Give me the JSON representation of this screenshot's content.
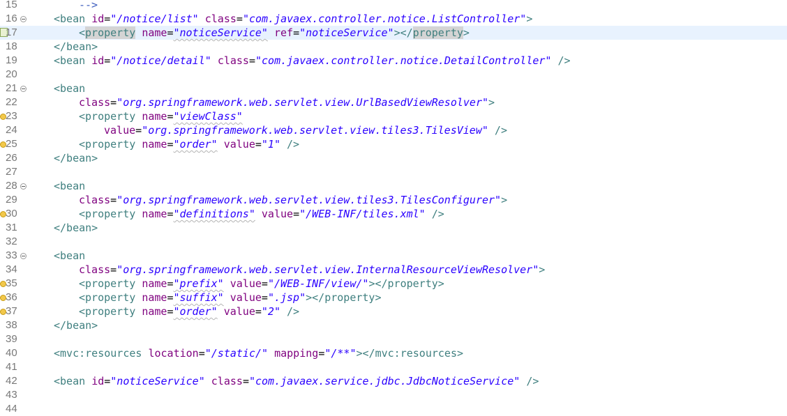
{
  "editor": {
    "current_line": 17,
    "lines": [
      {
        "n": "15",
        "fold": false,
        "marker": "",
        "indent": 1,
        "tokens": [
          {
            "t": "-->",
            "c": "comment"
          }
        ]
      },
      {
        "n": "16",
        "fold": true,
        "marker": "",
        "indent": 0,
        "tokens": [
          {
            "t": "<bean",
            "c": "tag"
          },
          {
            "t": " ",
            "c": "plain"
          },
          {
            "t": "id",
            "c": "attr"
          },
          {
            "t": "=",
            "c": "plain"
          },
          {
            "t": "\"/notice/list\"",
            "c": "val"
          },
          {
            "t": " ",
            "c": "plain"
          },
          {
            "t": "class",
            "c": "attr"
          },
          {
            "t": "=",
            "c": "plain"
          },
          {
            "t": "\"com.javaex.controller.notice.ListController\"",
            "c": "val"
          },
          {
            "t": ">",
            "c": "tag"
          }
        ]
      },
      {
        "n": "17",
        "fold": false,
        "marker": "bookmark",
        "indent": 1,
        "current": true,
        "tokens": [
          {
            "t": "<",
            "c": "tag"
          },
          {
            "t": "property",
            "c": "tag hl"
          },
          {
            "t": " ",
            "c": "plain"
          },
          {
            "t": "name",
            "c": "attr"
          },
          {
            "t": "=",
            "c": "plain"
          },
          {
            "t": "\"noticeService\"",
            "c": "val squig"
          },
          {
            "t": " ",
            "c": "plain"
          },
          {
            "t": "ref",
            "c": "attr"
          },
          {
            "t": "=",
            "c": "plain"
          },
          {
            "t": "\"noticeService\"",
            "c": "val"
          },
          {
            "t": "></",
            "c": "tag"
          },
          {
            "t": "property",
            "c": "tag hl"
          },
          {
            "t": ">",
            "c": "tag"
          }
        ]
      },
      {
        "n": "18",
        "fold": false,
        "marker": "",
        "indent": 0,
        "tokens": [
          {
            "t": "</bean>",
            "c": "tag"
          }
        ]
      },
      {
        "n": "19",
        "fold": false,
        "marker": "",
        "indent": 0,
        "tokens": [
          {
            "t": "<bean",
            "c": "tag"
          },
          {
            "t": " ",
            "c": "plain"
          },
          {
            "t": "id",
            "c": "attr"
          },
          {
            "t": "=",
            "c": "plain"
          },
          {
            "t": "\"/notice/detail\"",
            "c": "val"
          },
          {
            "t": " ",
            "c": "plain"
          },
          {
            "t": "class",
            "c": "attr"
          },
          {
            "t": "=",
            "c": "plain"
          },
          {
            "t": "\"com.javaex.controller.notice.DetailController\"",
            "c": "val"
          },
          {
            "t": " />",
            "c": "tag"
          }
        ]
      },
      {
        "n": "20",
        "fold": false,
        "marker": "",
        "indent": 0,
        "tokens": []
      },
      {
        "n": "21",
        "fold": true,
        "marker": "",
        "indent": 0,
        "tokens": [
          {
            "t": "<bean",
            "c": "tag"
          }
        ]
      },
      {
        "n": "22",
        "fold": false,
        "marker": "",
        "indent": 1,
        "tokens": [
          {
            "t": "class",
            "c": "attr"
          },
          {
            "t": "=",
            "c": "plain"
          },
          {
            "t": "\"org.springframework.web.servlet.view.UrlBasedViewResolver\"",
            "c": "val"
          },
          {
            "t": ">",
            "c": "tag"
          }
        ]
      },
      {
        "n": "23",
        "fold": false,
        "marker": "warning",
        "indent": 1,
        "tokens": [
          {
            "t": "<property",
            "c": "tag"
          },
          {
            "t": " ",
            "c": "plain"
          },
          {
            "t": "name",
            "c": "attr"
          },
          {
            "t": "=",
            "c": "plain"
          },
          {
            "t": "\"viewClass\"",
            "c": "val squig"
          }
        ]
      },
      {
        "n": "24",
        "fold": false,
        "marker": "",
        "indent": 2,
        "tokens": [
          {
            "t": "value",
            "c": "attr"
          },
          {
            "t": "=",
            "c": "plain"
          },
          {
            "t": "\"org.springframework.web.servlet.view.tiles3.TilesView\"",
            "c": "val"
          },
          {
            "t": " />",
            "c": "tag"
          }
        ]
      },
      {
        "n": "25",
        "fold": false,
        "marker": "warning",
        "indent": 1,
        "tokens": [
          {
            "t": "<property",
            "c": "tag"
          },
          {
            "t": " ",
            "c": "plain"
          },
          {
            "t": "name",
            "c": "attr"
          },
          {
            "t": "=",
            "c": "plain"
          },
          {
            "t": "\"order\"",
            "c": "val squig"
          },
          {
            "t": " ",
            "c": "plain"
          },
          {
            "t": "value",
            "c": "attr"
          },
          {
            "t": "=",
            "c": "plain"
          },
          {
            "t": "\"1\"",
            "c": "val"
          },
          {
            "t": " />",
            "c": "tag"
          }
        ]
      },
      {
        "n": "26",
        "fold": false,
        "marker": "",
        "indent": 0,
        "tokens": [
          {
            "t": "</bean>",
            "c": "tag"
          }
        ]
      },
      {
        "n": "27",
        "fold": false,
        "marker": "",
        "indent": 0,
        "tokens": []
      },
      {
        "n": "28",
        "fold": true,
        "marker": "",
        "indent": 0,
        "tokens": [
          {
            "t": "<bean",
            "c": "tag"
          }
        ]
      },
      {
        "n": "29",
        "fold": false,
        "marker": "",
        "indent": 1,
        "tokens": [
          {
            "t": "class",
            "c": "attr"
          },
          {
            "t": "=",
            "c": "plain"
          },
          {
            "t": "\"org.springframework.web.servlet.view.tiles3.TilesConfigurer\"",
            "c": "val"
          },
          {
            "t": ">",
            "c": "tag"
          }
        ]
      },
      {
        "n": "30",
        "fold": false,
        "marker": "warning",
        "indent": 1,
        "tokens": [
          {
            "t": "<property",
            "c": "tag"
          },
          {
            "t": " ",
            "c": "plain"
          },
          {
            "t": "name",
            "c": "attr"
          },
          {
            "t": "=",
            "c": "plain"
          },
          {
            "t": "\"definitions\"",
            "c": "val squig"
          },
          {
            "t": " ",
            "c": "plain"
          },
          {
            "t": "value",
            "c": "attr"
          },
          {
            "t": "=",
            "c": "plain"
          },
          {
            "t": "\"/WEB-INF/tiles.xml\"",
            "c": "val"
          },
          {
            "t": " />",
            "c": "tag"
          }
        ]
      },
      {
        "n": "31",
        "fold": false,
        "marker": "",
        "indent": 0,
        "tokens": [
          {
            "t": "</bean>",
            "c": "tag"
          }
        ]
      },
      {
        "n": "32",
        "fold": false,
        "marker": "",
        "indent": 0,
        "tokens": []
      },
      {
        "n": "33",
        "fold": true,
        "marker": "",
        "indent": 0,
        "tokens": [
          {
            "t": "<bean",
            "c": "tag"
          }
        ]
      },
      {
        "n": "34",
        "fold": false,
        "marker": "",
        "indent": 1,
        "tokens": [
          {
            "t": "class",
            "c": "attr"
          },
          {
            "t": "=",
            "c": "plain"
          },
          {
            "t": "\"org.springframework.web.servlet.view.InternalResourceViewResolver\"",
            "c": "val"
          },
          {
            "t": ">",
            "c": "tag"
          }
        ]
      },
      {
        "n": "35",
        "fold": false,
        "marker": "warning",
        "indent": 1,
        "tokens": [
          {
            "t": "<property",
            "c": "tag"
          },
          {
            "t": " ",
            "c": "plain"
          },
          {
            "t": "name",
            "c": "attr"
          },
          {
            "t": "=",
            "c": "plain"
          },
          {
            "t": "\"prefix\"",
            "c": "val squig"
          },
          {
            "t": " ",
            "c": "plain"
          },
          {
            "t": "value",
            "c": "attr"
          },
          {
            "t": "=",
            "c": "plain"
          },
          {
            "t": "\"/WEB-INF/view/\"",
            "c": "val"
          },
          {
            "t": "></property>",
            "c": "tag"
          }
        ]
      },
      {
        "n": "36",
        "fold": false,
        "marker": "warning",
        "indent": 1,
        "tokens": [
          {
            "t": "<property",
            "c": "tag"
          },
          {
            "t": " ",
            "c": "plain"
          },
          {
            "t": "name",
            "c": "attr"
          },
          {
            "t": "=",
            "c": "plain"
          },
          {
            "t": "\"suffix\"",
            "c": "val squig"
          },
          {
            "t": " ",
            "c": "plain"
          },
          {
            "t": "value",
            "c": "attr"
          },
          {
            "t": "=",
            "c": "plain"
          },
          {
            "t": "\".jsp\"",
            "c": "val"
          },
          {
            "t": "></property>",
            "c": "tag"
          }
        ]
      },
      {
        "n": "37",
        "fold": false,
        "marker": "warning",
        "indent": 1,
        "tokens": [
          {
            "t": "<property",
            "c": "tag"
          },
          {
            "t": " ",
            "c": "plain"
          },
          {
            "t": "name",
            "c": "attr"
          },
          {
            "t": "=",
            "c": "plain"
          },
          {
            "t": "\"order\"",
            "c": "val squig"
          },
          {
            "t": " ",
            "c": "plain"
          },
          {
            "t": "value",
            "c": "attr"
          },
          {
            "t": "=",
            "c": "plain"
          },
          {
            "t": "\"2\"",
            "c": "val"
          },
          {
            "t": " />",
            "c": "tag"
          }
        ]
      },
      {
        "n": "38",
        "fold": false,
        "marker": "",
        "indent": 0,
        "tokens": [
          {
            "t": "</bean>",
            "c": "tag"
          }
        ]
      },
      {
        "n": "39",
        "fold": false,
        "marker": "",
        "indent": 0,
        "tokens": []
      },
      {
        "n": "40",
        "fold": false,
        "marker": "",
        "indent": 0,
        "tokens": [
          {
            "t": "<mvc:resources",
            "c": "tag"
          },
          {
            "t": " ",
            "c": "plain"
          },
          {
            "t": "location",
            "c": "attr"
          },
          {
            "t": "=",
            "c": "plain"
          },
          {
            "t": "\"/static/\"",
            "c": "val"
          },
          {
            "t": " ",
            "c": "plain"
          },
          {
            "t": "mapping",
            "c": "attr"
          },
          {
            "t": "=",
            "c": "plain"
          },
          {
            "t": "\"/**\"",
            "c": "val"
          },
          {
            "t": "></mvc:resources>",
            "c": "tag"
          }
        ]
      },
      {
        "n": "41",
        "fold": false,
        "marker": "",
        "indent": 0,
        "tokens": []
      },
      {
        "n": "42",
        "fold": false,
        "marker": "",
        "indent": 0,
        "tokens": [
          {
            "t": "<bean",
            "c": "tag"
          },
          {
            "t": " ",
            "c": "plain"
          },
          {
            "t": "id",
            "c": "attr"
          },
          {
            "t": "=",
            "c": "plain"
          },
          {
            "t": "\"noticeService\"",
            "c": "val"
          },
          {
            "t": " ",
            "c": "plain"
          },
          {
            "t": "class",
            "c": "attr"
          },
          {
            "t": "=",
            "c": "plain"
          },
          {
            "t": "\"com.javaex.service.jdbc.JdbcNoticeService\"",
            "c": "val"
          },
          {
            "t": " />",
            "c": "tag"
          }
        ]
      },
      {
        "n": "43",
        "fold": false,
        "marker": "",
        "indent": 0,
        "tokens": []
      },
      {
        "n": "44",
        "fold": false,
        "marker": "",
        "indent": 0,
        "tokens": []
      }
    ]
  },
  "colors": {
    "tag": "#3f7f7f",
    "attribute": "#7f007f",
    "value": "#2a00ff",
    "comment": "#3f5fbf",
    "current_line_bg": "#e8f2fe",
    "line_number": "#787878"
  },
  "icons": {
    "fold": "fold-collapse-icon",
    "warning": "warning-icon",
    "bookmark": "current-line-marker-icon"
  }
}
